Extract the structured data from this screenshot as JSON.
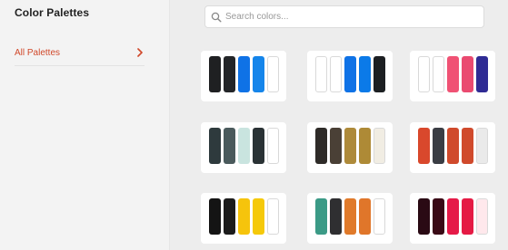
{
  "sidebar": {
    "title": "Color Palettes",
    "items": [
      {
        "label": "All Palettes",
        "icon": "chevron-right-icon"
      }
    ]
  },
  "search": {
    "placeholder": "Search colors...",
    "icon": "search-icon"
  },
  "colors": {
    "accent": "#d0482a"
  },
  "palettes": [
    [
      "#1f2022",
      "#232528",
      "#0f72e6",
      "#1585ea",
      "#ffffff"
    ],
    [
      "#ffffff",
      "#ffffff",
      "#0f72e6",
      "#0b7ae8",
      "#1c1f22"
    ],
    [
      "#ffffff",
      "#ffffff",
      "#f05274",
      "#ea4a70",
      "#2f2b94"
    ],
    [
      "#2e3a3d",
      "#4a5a5c",
      "#c9e4df",
      "#2a3235",
      "#ffffff"
    ],
    [
      "#2e2b28",
      "#4a4036",
      "#ae8a3a",
      "#ae8a36",
      "#f1ede3"
    ],
    [
      "#d9482c",
      "#3a3d44",
      "#d04a2c",
      "#d04a2c",
      "#eaeaea"
    ],
    [
      "#141414",
      "#1c1c1c",
      "#f6c40c",
      "#f5c90a",
      "#ffffff"
    ],
    [
      "#3b9a86",
      "#2f2f31",
      "#e07a2a",
      "#e0762a",
      "#ffffff"
    ],
    [
      "#2a0a14",
      "#3a0a16",
      "#e51a48",
      "#e51a44",
      "#ffe8ec"
    ]
  ]
}
